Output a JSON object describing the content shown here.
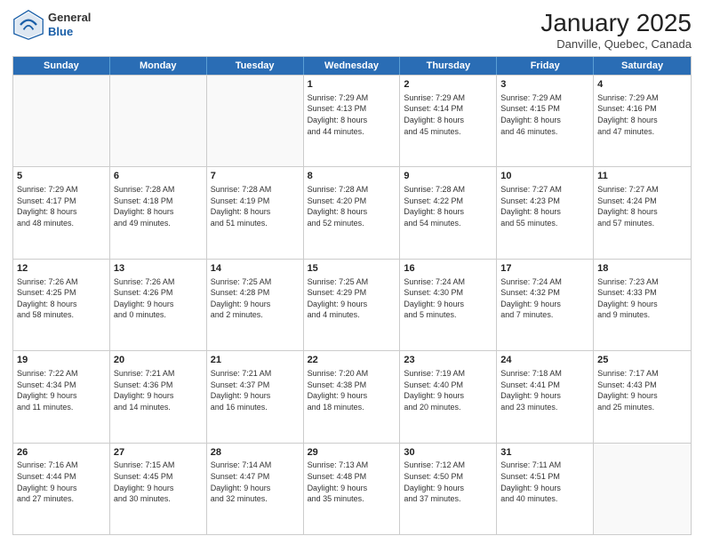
{
  "header": {
    "logo": {
      "general": "General",
      "blue": "Blue"
    },
    "title": "January 2025",
    "location": "Danville, Quebec, Canada"
  },
  "weekdays": [
    "Sunday",
    "Monday",
    "Tuesday",
    "Wednesday",
    "Thursday",
    "Friday",
    "Saturday"
  ],
  "rows": [
    [
      {
        "day": "",
        "info": "",
        "empty": true
      },
      {
        "day": "",
        "info": "",
        "empty": true
      },
      {
        "day": "",
        "info": "",
        "empty": true
      },
      {
        "day": "1",
        "info": "Sunrise: 7:29 AM\nSunset: 4:13 PM\nDaylight: 8 hours\nand 44 minutes."
      },
      {
        "day": "2",
        "info": "Sunrise: 7:29 AM\nSunset: 4:14 PM\nDaylight: 8 hours\nand 45 minutes."
      },
      {
        "day": "3",
        "info": "Sunrise: 7:29 AM\nSunset: 4:15 PM\nDaylight: 8 hours\nand 46 minutes."
      },
      {
        "day": "4",
        "info": "Sunrise: 7:29 AM\nSunset: 4:16 PM\nDaylight: 8 hours\nand 47 minutes."
      }
    ],
    [
      {
        "day": "5",
        "info": "Sunrise: 7:29 AM\nSunset: 4:17 PM\nDaylight: 8 hours\nand 48 minutes."
      },
      {
        "day": "6",
        "info": "Sunrise: 7:28 AM\nSunset: 4:18 PM\nDaylight: 8 hours\nand 49 minutes."
      },
      {
        "day": "7",
        "info": "Sunrise: 7:28 AM\nSunset: 4:19 PM\nDaylight: 8 hours\nand 51 minutes."
      },
      {
        "day": "8",
        "info": "Sunrise: 7:28 AM\nSunset: 4:20 PM\nDaylight: 8 hours\nand 52 minutes."
      },
      {
        "day": "9",
        "info": "Sunrise: 7:28 AM\nSunset: 4:22 PM\nDaylight: 8 hours\nand 54 minutes."
      },
      {
        "day": "10",
        "info": "Sunrise: 7:27 AM\nSunset: 4:23 PM\nDaylight: 8 hours\nand 55 minutes."
      },
      {
        "day": "11",
        "info": "Sunrise: 7:27 AM\nSunset: 4:24 PM\nDaylight: 8 hours\nand 57 minutes."
      }
    ],
    [
      {
        "day": "12",
        "info": "Sunrise: 7:26 AM\nSunset: 4:25 PM\nDaylight: 8 hours\nand 58 minutes."
      },
      {
        "day": "13",
        "info": "Sunrise: 7:26 AM\nSunset: 4:26 PM\nDaylight: 9 hours\nand 0 minutes."
      },
      {
        "day": "14",
        "info": "Sunrise: 7:25 AM\nSunset: 4:28 PM\nDaylight: 9 hours\nand 2 minutes."
      },
      {
        "day": "15",
        "info": "Sunrise: 7:25 AM\nSunset: 4:29 PM\nDaylight: 9 hours\nand 4 minutes."
      },
      {
        "day": "16",
        "info": "Sunrise: 7:24 AM\nSunset: 4:30 PM\nDaylight: 9 hours\nand 5 minutes."
      },
      {
        "day": "17",
        "info": "Sunrise: 7:24 AM\nSunset: 4:32 PM\nDaylight: 9 hours\nand 7 minutes."
      },
      {
        "day": "18",
        "info": "Sunrise: 7:23 AM\nSunset: 4:33 PM\nDaylight: 9 hours\nand 9 minutes."
      }
    ],
    [
      {
        "day": "19",
        "info": "Sunrise: 7:22 AM\nSunset: 4:34 PM\nDaylight: 9 hours\nand 11 minutes."
      },
      {
        "day": "20",
        "info": "Sunrise: 7:21 AM\nSunset: 4:36 PM\nDaylight: 9 hours\nand 14 minutes."
      },
      {
        "day": "21",
        "info": "Sunrise: 7:21 AM\nSunset: 4:37 PM\nDaylight: 9 hours\nand 16 minutes."
      },
      {
        "day": "22",
        "info": "Sunrise: 7:20 AM\nSunset: 4:38 PM\nDaylight: 9 hours\nand 18 minutes."
      },
      {
        "day": "23",
        "info": "Sunrise: 7:19 AM\nSunset: 4:40 PM\nDaylight: 9 hours\nand 20 minutes."
      },
      {
        "day": "24",
        "info": "Sunrise: 7:18 AM\nSunset: 4:41 PM\nDaylight: 9 hours\nand 23 minutes."
      },
      {
        "day": "25",
        "info": "Sunrise: 7:17 AM\nSunset: 4:43 PM\nDaylight: 9 hours\nand 25 minutes."
      }
    ],
    [
      {
        "day": "26",
        "info": "Sunrise: 7:16 AM\nSunset: 4:44 PM\nDaylight: 9 hours\nand 27 minutes."
      },
      {
        "day": "27",
        "info": "Sunrise: 7:15 AM\nSunset: 4:45 PM\nDaylight: 9 hours\nand 30 minutes."
      },
      {
        "day": "28",
        "info": "Sunrise: 7:14 AM\nSunset: 4:47 PM\nDaylight: 9 hours\nand 32 minutes."
      },
      {
        "day": "29",
        "info": "Sunrise: 7:13 AM\nSunset: 4:48 PM\nDaylight: 9 hours\nand 35 minutes."
      },
      {
        "day": "30",
        "info": "Sunrise: 7:12 AM\nSunset: 4:50 PM\nDaylight: 9 hours\nand 37 minutes."
      },
      {
        "day": "31",
        "info": "Sunrise: 7:11 AM\nSunset: 4:51 PM\nDaylight: 9 hours\nand 40 minutes."
      },
      {
        "day": "",
        "info": "",
        "empty": true
      }
    ]
  ]
}
